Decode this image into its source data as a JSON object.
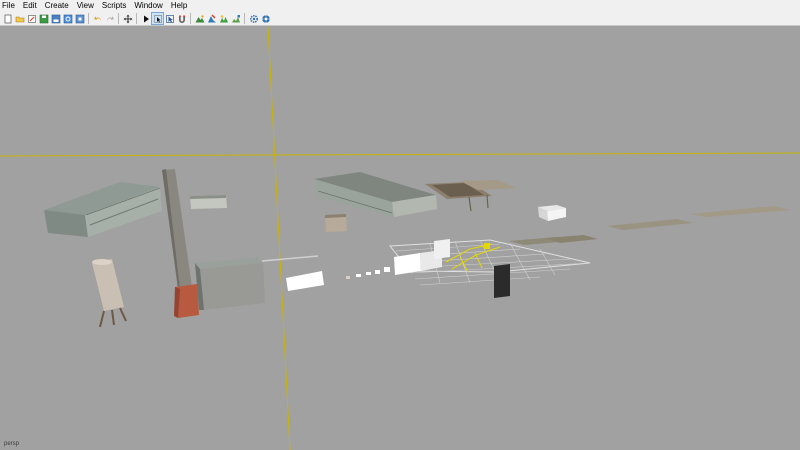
{
  "menu": {
    "items": [
      "File",
      "Edit",
      "Create",
      "View",
      "Scripts",
      "Window",
      "Help"
    ]
  },
  "toolbar": {
    "buttons": [
      "new-scene-icon",
      "open-icon",
      "edit-icon",
      "save-icon",
      "save-all-icon",
      "reload-icon",
      "stop-icon",
      "undo-icon",
      "redo-icon",
      "move-icon",
      "play-icon",
      "select-icon",
      "cursor-icon",
      "magnet-icon",
      "terrain-icon",
      "paint-icon",
      "foliage-icon",
      "decal-icon",
      "settings-icon",
      "world-icon"
    ]
  },
  "viewport": {
    "label": "persp",
    "background_color": "#a1a1a1",
    "axis_color": "#c8b400"
  }
}
